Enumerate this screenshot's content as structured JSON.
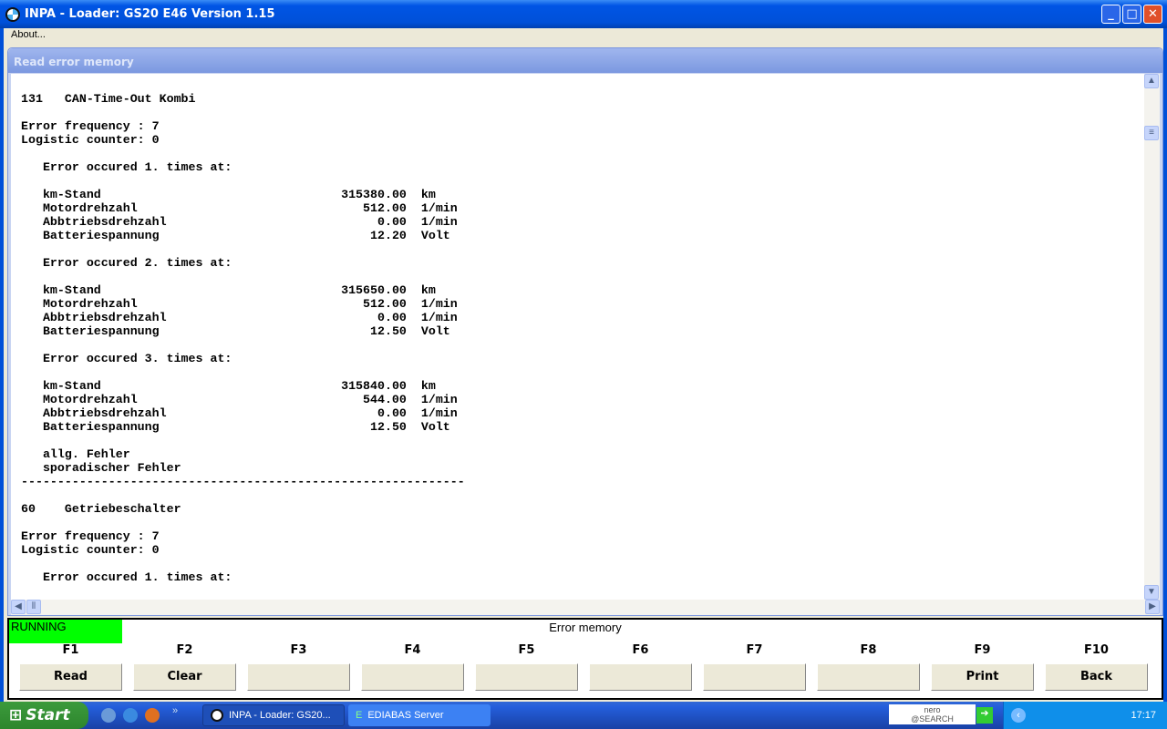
{
  "window": {
    "title": "INPA - Loader:  GS20 E46 Version 1.15"
  },
  "menu": {
    "about": "About..."
  },
  "panel": {
    "title": "Read error memory"
  },
  "lines": [
    "131   CAN-Time-Out Kombi",
    "",
    "Error frequency : 7",
    "Logistic counter: 0",
    "",
    "   Error occured 1. times at:",
    "",
    {
      "label": "km-Stand",
      "value": "315380.00",
      "unit": "km"
    },
    {
      "label": "Motordrehzahl",
      "value": "512.00",
      "unit": "1/min"
    },
    {
      "label": "Abbtriebsdrehzahl",
      "value": "0.00",
      "unit": "1/min"
    },
    {
      "label": "Batteriespannung",
      "value": "12.20",
      "unit": "Volt"
    },
    "",
    "   Error occured 2. times at:",
    "",
    {
      "label": "km-Stand",
      "value": "315650.00",
      "unit": "km"
    },
    {
      "label": "Motordrehzahl",
      "value": "512.00",
      "unit": "1/min"
    },
    {
      "label": "Abbtriebsdrehzahl",
      "value": "0.00",
      "unit": "1/min"
    },
    {
      "label": "Batteriespannung",
      "value": "12.50",
      "unit": "Volt"
    },
    "",
    "   Error occured 3. times at:",
    "",
    {
      "label": "km-Stand",
      "value": "315840.00",
      "unit": "km"
    },
    {
      "label": "Motordrehzahl",
      "value": "544.00",
      "unit": "1/min"
    },
    {
      "label": "Abbtriebsdrehzahl",
      "value": "0.00",
      "unit": "1/min"
    },
    {
      "label": "Batteriespannung",
      "value": "12.50",
      "unit": "Volt"
    },
    "",
    "   allg. Fehler",
    "   sporadischer Fehler",
    "-------------------------------------------------------------",
    "",
    "60    Getriebeschalter",
    "",
    "Error frequency : 7",
    "Logistic counter: 0",
    "",
    "   Error occured 1. times at:"
  ],
  "status": {
    "state": "RUNNING",
    "title": "Error memory",
    "state_color": "#00ff00"
  },
  "fkeys": [
    {
      "key": "F1",
      "label": "Read"
    },
    {
      "key": "F2",
      "label": "Clear"
    },
    {
      "key": "F3",
      "label": ""
    },
    {
      "key": "F4",
      "label": ""
    },
    {
      "key": "F5",
      "label": ""
    },
    {
      "key": "F6",
      "label": ""
    },
    {
      "key": "F7",
      "label": ""
    },
    {
      "key": "F8",
      "label": ""
    },
    {
      "key": "F9",
      "label": "Print"
    },
    {
      "key": "F10",
      "label": "Back"
    }
  ],
  "taskbar": {
    "start": "Start",
    "tasks": [
      "INPA - Loader:  GS20...",
      "EDIABAS Server"
    ],
    "nero": "nero\n@SEARCH",
    "clock": "17:17",
    "overflow": "»"
  }
}
